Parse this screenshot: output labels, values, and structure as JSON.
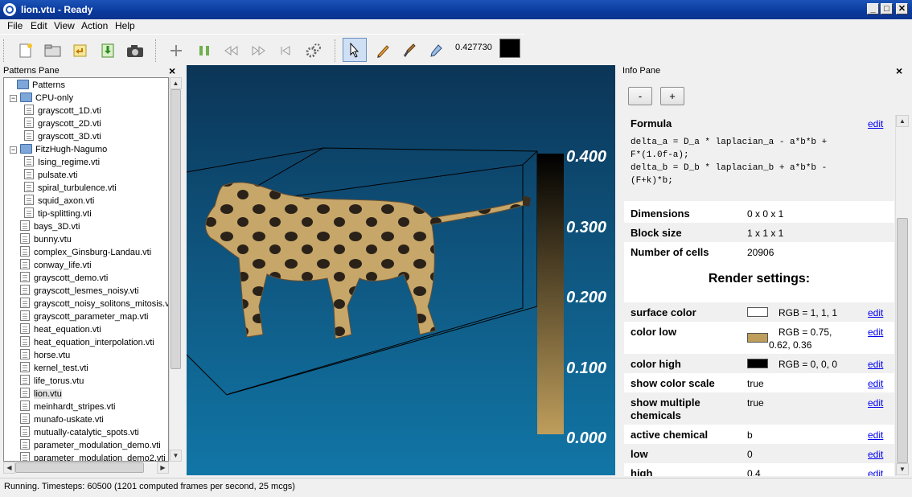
{
  "window": {
    "title": "lion.vtu - Ready"
  },
  "menu": [
    "File",
    "Edit",
    "View",
    "Action",
    "Help"
  ],
  "toolbar": {
    "timestep_value": "0.427730",
    "current_color": "#000000"
  },
  "patterns_pane": {
    "title": "Patterns Pane",
    "root": "Patterns",
    "folders": [
      {
        "name": "CPU-only",
        "files": [
          "grayscott_1D.vti",
          "grayscott_2D.vti",
          "grayscott_3D.vti"
        ]
      },
      {
        "name": "FitzHugh-Nagumo",
        "files": [
          "Ising_regime.vti",
          "pulsate.vti",
          "spiral_turbulence.vti",
          "squid_axon.vti",
          "tip-splitting.vti"
        ]
      }
    ],
    "files": [
      "bays_3D.vti",
      "bunny.vtu",
      "complex_Ginsburg-Landau.vti",
      "conway_life.vti",
      "grayscott_demo.vti",
      "grayscott_lesmes_noisy.vti",
      "grayscott_noisy_solitons_mitosis.vti",
      "grayscott_parameter_map.vti",
      "heat_equation.vti",
      "heat_equation_interpolation.vti",
      "horse.vtu",
      "kernel_test.vti",
      "life_torus.vtu",
      "lion.vtu",
      "meinhardt_stripes.vti",
      "munafo-uskate.vti",
      "mutually-catalytic_spots.vti",
      "parameter_modulation_demo.vti",
      "parameter_modulation_demo2.vti"
    ],
    "selected": "lion.vtu"
  },
  "viewport": {
    "color_scale_labels": [
      "0.400",
      "0.300",
      "0.200",
      "0.100",
      "0.000"
    ],
    "color_high": "#000000",
    "color_low": "#bf9e5c"
  },
  "info_pane": {
    "title": "Info Pane",
    "minus": "-",
    "plus": "+",
    "formula_label": "Formula",
    "formula_lines": [
      "delta_a = D_a * laplacian_a - a*b*b +",
      "F*(1.0f-a);",
      "delta_b = D_b * laplacian_b + a*b*b -",
      "(F+k)*b;"
    ],
    "edit": "edit",
    "rows": [
      {
        "label": "Dimensions",
        "value": "0 x 0 x 1"
      },
      {
        "label": "Block size",
        "value": "1 x 1 x 1"
      },
      {
        "label": "Number of cells",
        "value": "20906"
      }
    ],
    "render_heading": "Render settings:",
    "settings": [
      {
        "label": "surface color",
        "value": "RGB = 1, 1, 1",
        "color": "#ffffff"
      },
      {
        "label": "color low",
        "value_line1": "RGB = 0.75,",
        "value_line2": "0.62, 0.36",
        "color": "#bf9e5c"
      },
      {
        "label": "color high",
        "value": "RGB = 0, 0, 0",
        "color": "#000000"
      },
      {
        "label": "show color scale",
        "value": "true"
      },
      {
        "label_line1": "show multiple",
        "label_line2": "chemicals",
        "value": "true"
      },
      {
        "label": "active chemical",
        "value": "b"
      },
      {
        "label": "low",
        "value": "0"
      },
      {
        "label": "high",
        "value": "0.4"
      }
    ]
  },
  "status": {
    "text": "Running. Timesteps: 60500   (1201 computed frames per second, 25 mcgs)"
  }
}
